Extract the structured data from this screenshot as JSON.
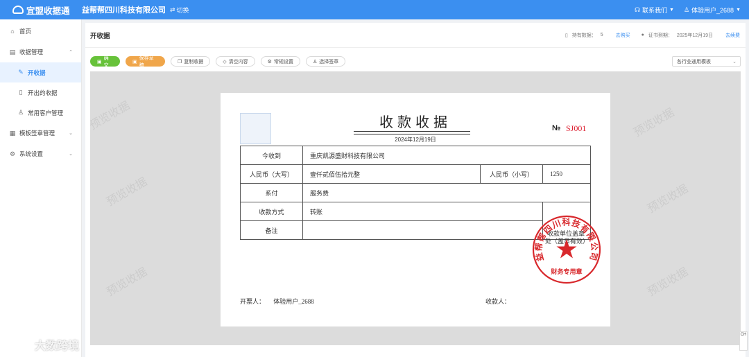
{
  "topbar": {
    "brand": "宜盟收据通",
    "company": "益帮帮四川科技有限公司",
    "switch": "切换",
    "contact": "联系我们",
    "user": "体验用户_2688"
  },
  "sidebar": {
    "items": [
      {
        "label": "首页",
        "icon": "home-icon"
      },
      {
        "label": "收据管理",
        "icon": "receipt-icon"
      },
      {
        "label": "开收据",
        "icon": "edit-icon"
      },
      {
        "label": "开出的收据",
        "icon": "document-icon"
      },
      {
        "label": "常用客户管理",
        "icon": "user-icon"
      },
      {
        "label": "模板签章管理",
        "icon": "template-icon"
      },
      {
        "label": "系统设置",
        "icon": "gear-icon"
      }
    ]
  },
  "page": {
    "title": "开收据",
    "quota_label": "持有数据：",
    "quota_value": "5",
    "buy_label": "去购买",
    "cert_label": "证书到期：",
    "cert_value": "2025年12月19日",
    "renew_label": "去续费"
  },
  "toolbar": {
    "submit": "确交",
    "save": "保存草稿",
    "copy": "复制收据",
    "clear": "清空内容",
    "settings": "常规设置",
    "sign": "选择签章",
    "template": "各行业通用模板"
  },
  "receipt": {
    "title": "收款收据",
    "date": "2024年12月19日",
    "no_label": "№",
    "no_value": "SJ001",
    "row_payer_label": "今收到",
    "row_payer_value": "重庆凯源盛财科技有限公司",
    "row_upper_label": "人民币（大写）",
    "row_upper_value": "壹仟贰佰伍拾元整",
    "row_lower_label": "人民币（小写）",
    "row_lower_value": "1250",
    "row_for_label": "系付",
    "row_for_value": "服务费",
    "row_method_label": "收款方式",
    "row_method_value": "转账",
    "row_remark_label": "备注",
    "seal_text": "收款单位盖章处（盖章有效）",
    "seal_name": "益帮帮四川科技有限公司",
    "seal_bottom": "财务专用章",
    "issuer_label": "开票人：",
    "issuer_value": "体验用户_2688",
    "payee_label": "收款人："
  },
  "watermark": "预览收据",
  "corner_logo": "大数跨境",
  "side_widget": "CH",
  "colors": {
    "primary": "#3b8ff0",
    "green": "#67c23a",
    "orange": "#f0a64a",
    "seal": "#d8282c"
  }
}
